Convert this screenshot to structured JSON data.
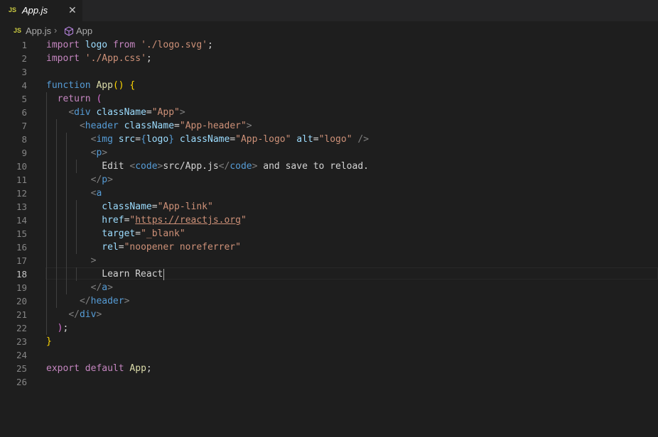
{
  "tab": {
    "lang_badge": "JS",
    "title": "App.js",
    "close_glyph": "✕"
  },
  "breadcrumb": {
    "lang_badge": "JS",
    "file": "App.js",
    "separator": "›",
    "symbol": "App",
    "symbol_icon": "cube-icon"
  },
  "editor": {
    "active_line": 18,
    "lines": [
      {
        "n": "1"
      },
      {
        "n": "2"
      },
      {
        "n": "3"
      },
      {
        "n": "4"
      },
      {
        "n": "5"
      },
      {
        "n": "6"
      },
      {
        "n": "7"
      },
      {
        "n": "8"
      },
      {
        "n": "9"
      },
      {
        "n": "10"
      },
      {
        "n": "11"
      },
      {
        "n": "12"
      },
      {
        "n": "13"
      },
      {
        "n": "14"
      },
      {
        "n": "15"
      },
      {
        "n": "16"
      },
      {
        "n": "17"
      },
      {
        "n": "18"
      },
      {
        "n": "19"
      },
      {
        "n": "20"
      },
      {
        "n": "21"
      },
      {
        "n": "22"
      },
      {
        "n": "23"
      },
      {
        "n": "24"
      },
      {
        "n": "25"
      },
      {
        "n": "26"
      }
    ],
    "code": {
      "l1": [
        [
          "kw",
          "import"
        ],
        [
          "txt",
          " "
        ],
        [
          "id",
          "logo"
        ],
        [
          "txt",
          " "
        ],
        [
          "kw",
          "from"
        ],
        [
          "txt",
          " "
        ],
        [
          "str",
          "'./logo.svg'"
        ],
        [
          "txt",
          ";"
        ]
      ],
      "l2": [
        [
          "kw",
          "import"
        ],
        [
          "txt",
          " "
        ],
        [
          "str",
          "'./App.css'"
        ],
        [
          "txt",
          ";"
        ]
      ],
      "l3": [],
      "l4": [
        [
          "kwb",
          "function"
        ],
        [
          "txt",
          " "
        ],
        [
          "fn",
          "App"
        ],
        [
          "br1",
          "()"
        ],
        [
          "txt",
          " "
        ],
        [
          "br1",
          "{"
        ]
      ],
      "l5": [
        [
          "txt",
          "  "
        ],
        [
          "kw",
          "return"
        ],
        [
          "txt",
          " "
        ],
        [
          "br2",
          "("
        ]
      ],
      "l6": [
        [
          "txt",
          "    "
        ],
        [
          "ang",
          "<"
        ],
        [
          "tag",
          "div"
        ],
        [
          "txt",
          " "
        ],
        [
          "attr",
          "className"
        ],
        [
          "txt",
          "="
        ],
        [
          "str",
          "\"App\""
        ],
        [
          "ang",
          ">"
        ]
      ],
      "l7": [
        [
          "txt",
          "      "
        ],
        [
          "ang",
          "<"
        ],
        [
          "tag",
          "header"
        ],
        [
          "txt",
          " "
        ],
        [
          "attr",
          "className"
        ],
        [
          "txt",
          "="
        ],
        [
          "str",
          "\"App-header\""
        ],
        [
          "ang",
          ">"
        ]
      ],
      "l8": [
        [
          "txt",
          "        "
        ],
        [
          "ang",
          "<"
        ],
        [
          "tag",
          "img"
        ],
        [
          "txt",
          " "
        ],
        [
          "attr",
          "src"
        ],
        [
          "txt",
          "="
        ],
        [
          "kwb",
          "{"
        ],
        [
          "id",
          "logo"
        ],
        [
          "kwb",
          "}"
        ],
        [
          "txt",
          " "
        ],
        [
          "attr",
          "className"
        ],
        [
          "txt",
          "="
        ],
        [
          "str",
          "\"App-logo\""
        ],
        [
          "txt",
          " "
        ],
        [
          "attr",
          "alt"
        ],
        [
          "txt",
          "="
        ],
        [
          "str",
          "\"logo\""
        ],
        [
          "txt",
          " "
        ],
        [
          "ang",
          "/>"
        ]
      ],
      "l9": [
        [
          "txt",
          "        "
        ],
        [
          "ang",
          "<"
        ],
        [
          "tag",
          "p"
        ],
        [
          "ang",
          ">"
        ]
      ],
      "l10": [
        [
          "txt",
          "          Edit "
        ],
        [
          "ang",
          "<"
        ],
        [
          "tag",
          "code"
        ],
        [
          "ang",
          ">"
        ],
        [
          "txt",
          "src/App.js"
        ],
        [
          "ang",
          "</"
        ],
        [
          "tag",
          "code"
        ],
        [
          "ang",
          ">"
        ],
        [
          "txt",
          " and save to reload."
        ]
      ],
      "l11": [
        [
          "txt",
          "        "
        ],
        [
          "ang",
          "</"
        ],
        [
          "tag",
          "p"
        ],
        [
          "ang",
          ">"
        ]
      ],
      "l12": [
        [
          "txt",
          "        "
        ],
        [
          "ang",
          "<"
        ],
        [
          "tag",
          "a"
        ]
      ],
      "l13": [
        [
          "txt",
          "          "
        ],
        [
          "attr",
          "className"
        ],
        [
          "txt",
          "="
        ],
        [
          "str",
          "\"App-link\""
        ]
      ],
      "l14": [
        [
          "txt",
          "          "
        ],
        [
          "attr",
          "href"
        ],
        [
          "txt",
          "="
        ],
        [
          "str",
          "\""
        ],
        [
          "link",
          "https://reactjs.org"
        ],
        [
          "str",
          "\""
        ]
      ],
      "l15": [
        [
          "txt",
          "          "
        ],
        [
          "attr",
          "target"
        ],
        [
          "txt",
          "="
        ],
        [
          "str",
          "\"_blank\""
        ]
      ],
      "l16": [
        [
          "txt",
          "          "
        ],
        [
          "attr",
          "rel"
        ],
        [
          "txt",
          "="
        ],
        [
          "str",
          "\"noopener noreferrer\""
        ]
      ],
      "l17": [
        [
          "txt",
          "        "
        ],
        [
          "ang",
          ">"
        ]
      ],
      "l18": [
        [
          "txt",
          "          Learn React"
        ]
      ],
      "l19": [
        [
          "txt",
          "        "
        ],
        [
          "ang",
          "</"
        ],
        [
          "tag",
          "a"
        ],
        [
          "ang",
          ">"
        ]
      ],
      "l20": [
        [
          "txt",
          "      "
        ],
        [
          "ang",
          "</"
        ],
        [
          "tag",
          "header"
        ],
        [
          "ang",
          ">"
        ]
      ],
      "l21": [
        [
          "txt",
          "    "
        ],
        [
          "ang",
          "</"
        ],
        [
          "tag",
          "div"
        ],
        [
          "ang",
          ">"
        ]
      ],
      "l22": [
        [
          "txt",
          "  "
        ],
        [
          "br2",
          ")"
        ],
        [
          "txt",
          ";"
        ]
      ],
      "l23": [
        [
          "br1",
          "}"
        ]
      ],
      "l24": [],
      "l25": [
        [
          "kw",
          "export"
        ],
        [
          "txt",
          " "
        ],
        [
          "kw",
          "default"
        ],
        [
          "txt",
          " "
        ],
        [
          "fn",
          "App"
        ],
        [
          "txt",
          ";"
        ]
      ],
      "l26": []
    }
  }
}
